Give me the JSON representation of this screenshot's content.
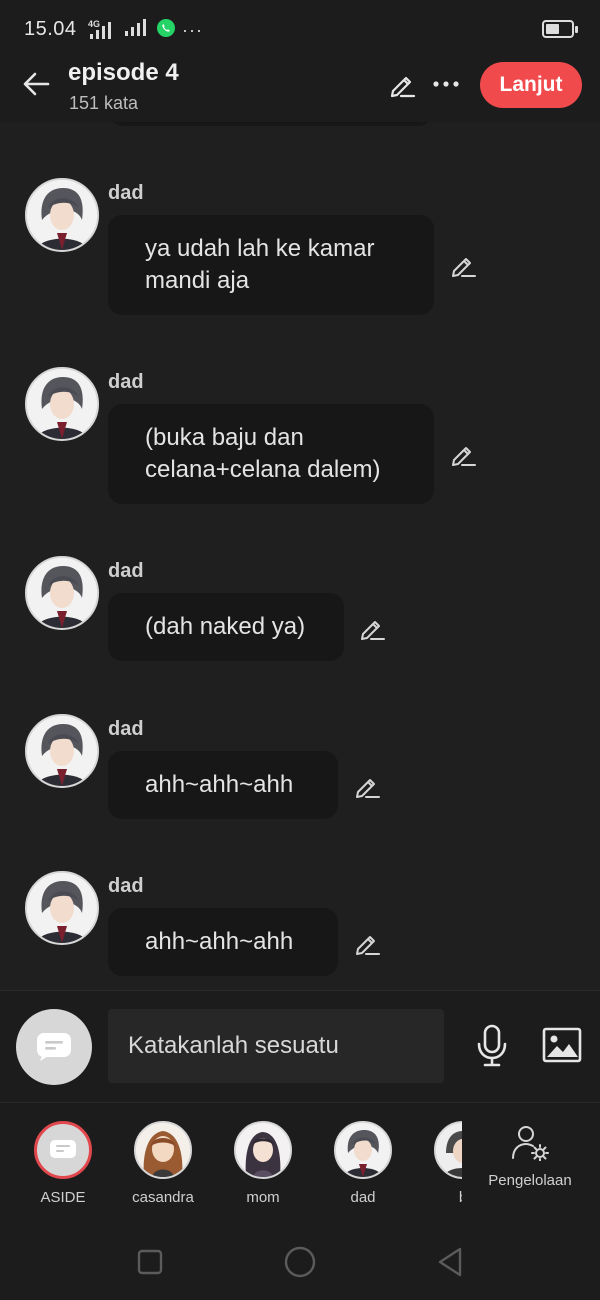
{
  "status_bar": {
    "time": "15.04",
    "network": "4G",
    "icons": [
      "signal-icon",
      "signal-icon",
      "whatsapp-icon",
      "more-dots-icon",
      "battery-icon"
    ]
  },
  "header": {
    "title": "episode 4",
    "subtitle": "151 kata",
    "next_label": "Lanjut",
    "accent_color": "#f04a4d"
  },
  "messages": [
    {
      "sender": "dad",
      "text": "ya udah lah ke kamar mandi aja"
    },
    {
      "sender": "dad",
      "text": "(buka baju dan celana+celana dalem)"
    },
    {
      "sender": "dad",
      "text": "(dah naked ya)"
    },
    {
      "sender": "dad",
      "text": "ahh~ahh~ahh"
    },
    {
      "sender": "dad",
      "text": "ahh~ahh~ahh"
    }
  ],
  "composer": {
    "placeholder": "Katakanlah sesuatu"
  },
  "cast": [
    {
      "name": "ASIDE"
    },
    {
      "name": "casandra"
    },
    {
      "name": "mom"
    },
    {
      "name": "dad"
    },
    {
      "name": "b"
    }
  ],
  "manage_label": "Pengelolaan"
}
